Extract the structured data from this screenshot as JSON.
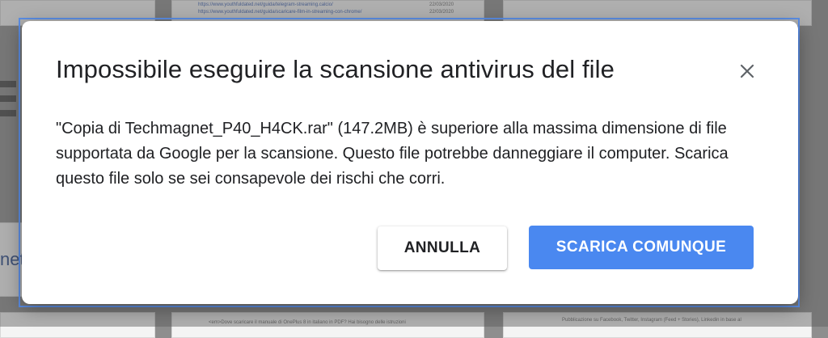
{
  "background": {
    "links": [
      "https://www.youthfuldated.net/guida/telegram-streaming.calcio/",
      "https://www.youthfuldated.net/guida/scaricare-film-in-streaming-con-chrome/"
    ],
    "dates": [
      "22/03/2020",
      "22/03/2020"
    ],
    "side_label": "net_",
    "bottom_snippet_left": "<em>Dove scaricare il manuale di OnePlus 8 in italiano in PDF? Hai bisogno delle istruzioni",
    "bottom_snippet_right": "Pubblicazione su Facebook, Twitter, Instagram (Feed + Stories), Linkedin in base al"
  },
  "dialog": {
    "title": "Impossibile eseguire la scansione antivirus del file",
    "body": "\"Copia di Techmagnet_P40_H4CK.rar\" (147.2MB) è superiore alla massima dimensione di file supportata da Google per la scansione. Questo file potrebbe danneggiare il computer. Scarica questo file solo se sei consapevole dei rischi che corri.",
    "cancel_label": "ANNULLA",
    "download_label": "SCARICA COMUNQUE",
    "close_icon": "close-icon"
  },
  "colors": {
    "primary": "#4a88f0",
    "text": "#202124",
    "selection_outline": "#5b8ee6"
  }
}
